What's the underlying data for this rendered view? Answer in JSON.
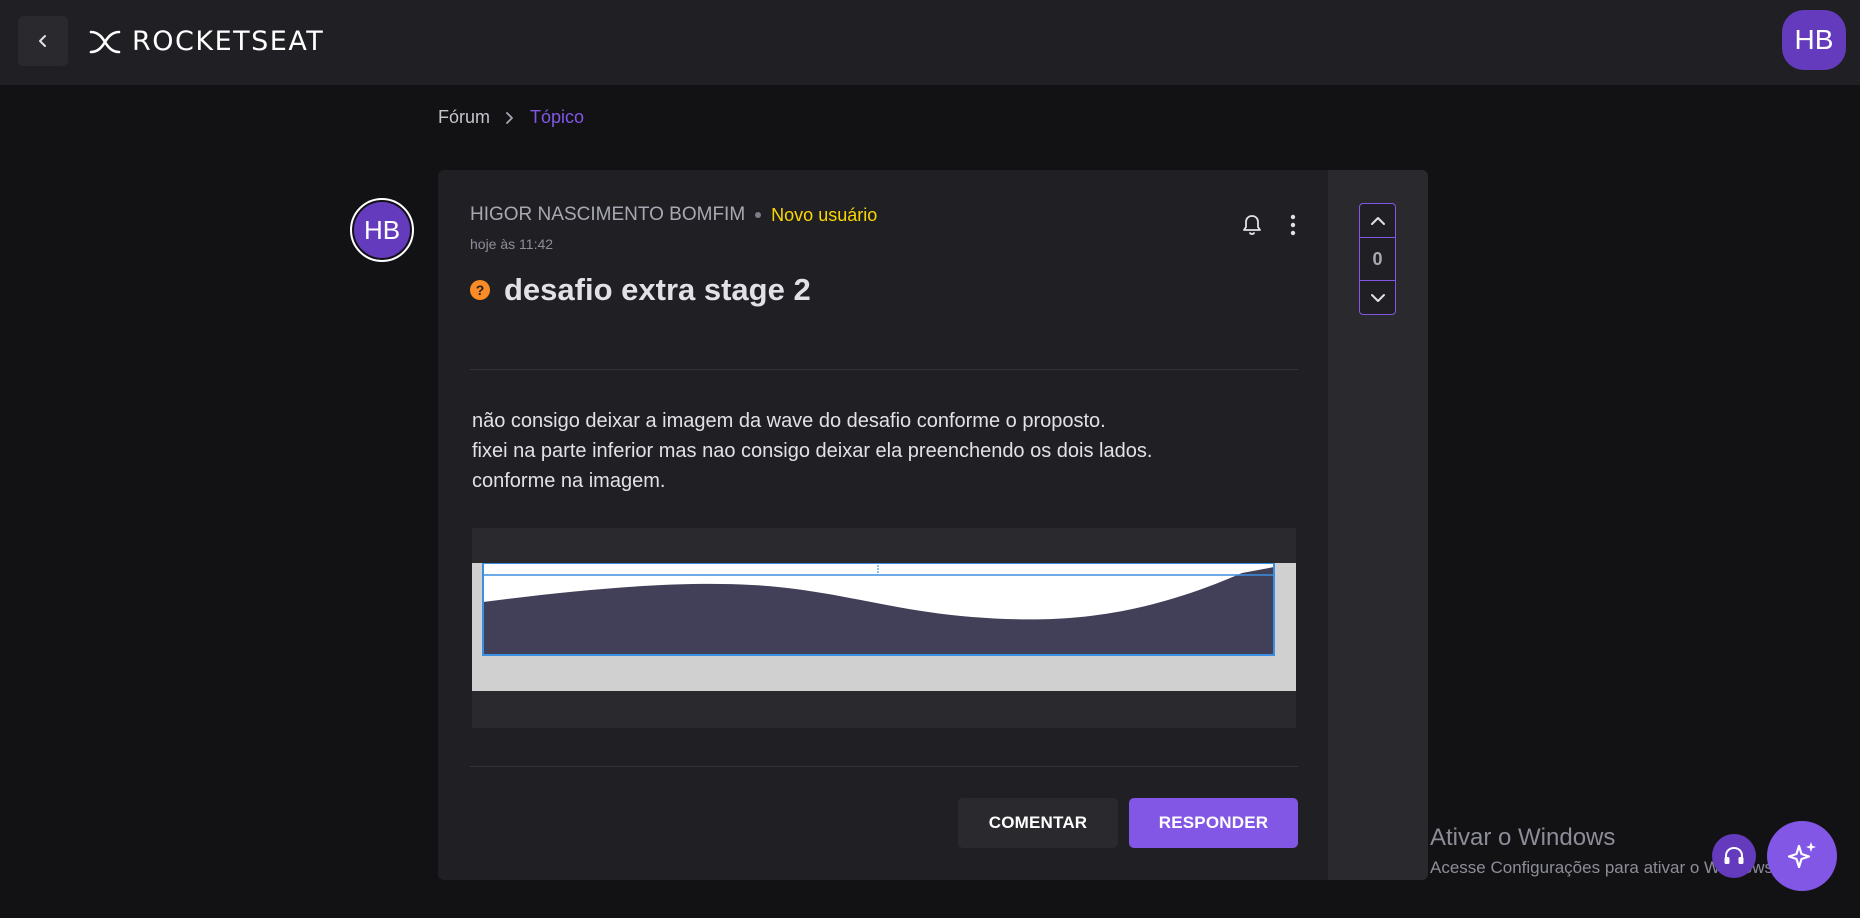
{
  "header": {
    "logo_text": "ROCKETSEAT",
    "user_initials": "HB"
  },
  "breadcrumb": {
    "forum": "Fórum",
    "topic": "Tópico"
  },
  "post": {
    "author_initials": "HB",
    "author_name": "HIGOR NASCIMENTO BOMFIM",
    "author_badge": "Novo usuário",
    "time": "hoje às 11:42",
    "title": "desafio extra stage 2",
    "body_lines": [
      "não consigo deixar a imagem da wave do desafio conforme o proposto.",
      "fixei na parte inferior mas nao consigo deixar ela preenchendo os dois lados.",
      "conforme na imagem."
    ],
    "comment_label": "COMENTAR",
    "reply_label": "RESPONDER",
    "vote_count": "0"
  },
  "windows_watermark": {
    "title": "Ativar o Windows",
    "subtitle": "Acesse Configurações para ativar o Windows."
  },
  "colors": {
    "accent": "#8257e5",
    "avatar": "#633bbc",
    "badge": "#fbd600",
    "question": "#fb8b24"
  },
  "icons": [
    "chevron-left-icon",
    "rocketseat-logo-icon",
    "chevron-right-icon",
    "bell-icon",
    "more-vertical-icon",
    "question-icon",
    "chevron-up-icon",
    "chevron-down-icon",
    "headset-icon",
    "sparkles-icon"
  ]
}
